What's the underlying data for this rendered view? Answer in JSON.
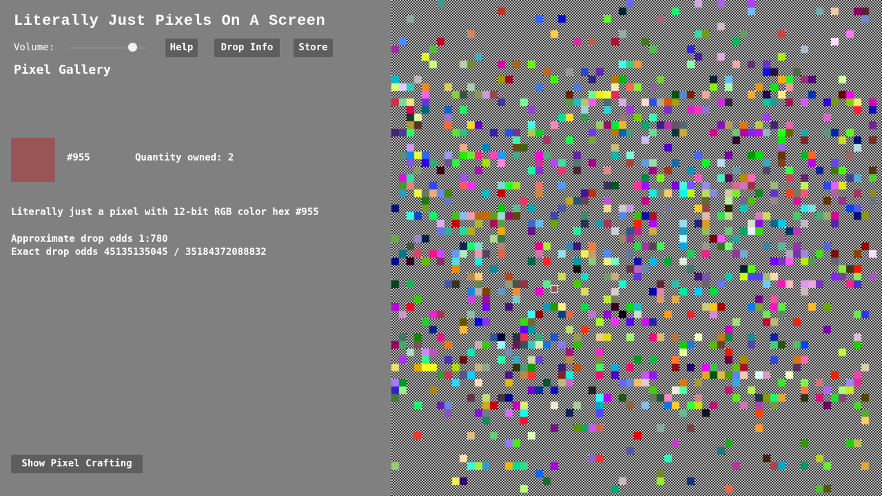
{
  "app": {
    "title": "Literally Just Pixels On A Screen"
  },
  "toolbar": {
    "volume_label": "Volume:",
    "volume_level": 0.8,
    "help_label": "Help",
    "drop_info_label": "Drop Info",
    "store_label": "Store"
  },
  "gallery": {
    "heading": "Pixel Gallery",
    "selected": {
      "color": "#955",
      "swatch_color": "#995555",
      "hex_label": "#955",
      "quantity_label": "Quantity owned: 2",
      "description": "Literally just a pixel with 12-bit RGB color hex #955",
      "approx_odds": "Approximate drop odds 1:780",
      "exact_odds": "Exact drop odds 45135135045 / 35184372088832"
    }
  },
  "crafting": {
    "button_label": "Show Pixel Crafting"
  },
  "colors": {
    "background": "#808080",
    "button": "#5e5e5e",
    "text": "#ffffff"
  },
  "icons": {
    "volume_thumb": "slider-thumb"
  }
}
